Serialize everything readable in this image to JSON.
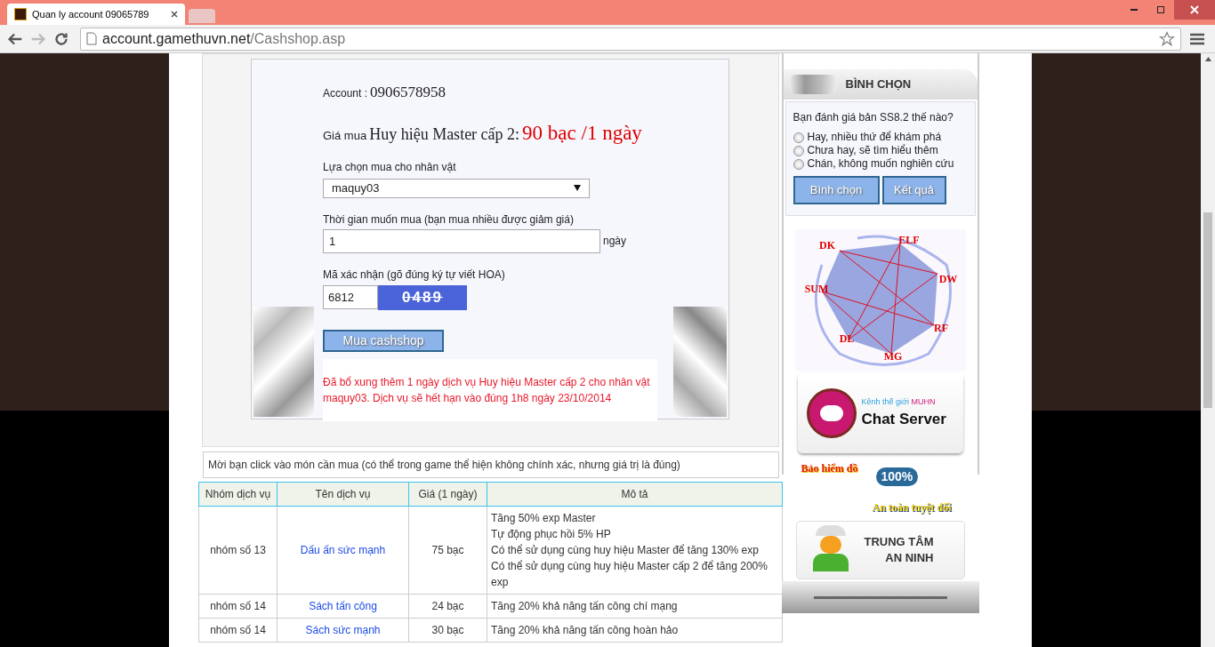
{
  "browser": {
    "tab_title": "Quan ly account 09065789",
    "url_host": "account.gamethuvn.net",
    "url_path": "/Cashshop.asp"
  },
  "form": {
    "account_label": "Account :",
    "account_value": "0906578958",
    "price_label": "Giá mua",
    "item_name": "Huy hiệu Master cấp 2:",
    "price_value": "90 bạc /1 ngày",
    "character_label": "Lựa chọn mua cho nhân vật",
    "character_value": "maquy03",
    "duration_label": "Thời gian muốn mua (bạn mua nhiều được giảm giá)",
    "duration_value": "1",
    "duration_unit": "ngày",
    "captcha_label": "Mã xác nhận (gõ đúng ký tự viết HOA)",
    "captcha_value": "6812",
    "captcha_text": "0489",
    "submit": "Mua cashshop",
    "message": "Đã bổ xung thêm 1 ngày dịch vụ Huy hiệu Master cấp 2 cho nhân vật maquy03. Dịch vụ sẽ hết hạn vào đúng 1h8 ngày 23/10/2014"
  },
  "notice": "Mời bạn click vào món cần mua (có thể trong game thể hiện không chính xác, nhưng giá trị là đúng)",
  "table": {
    "columns": [
      "Nhóm dịch vụ",
      "Tên dịch vụ",
      "Giá (1 ngày)",
      "Mô tả"
    ],
    "rows": [
      {
        "group": "nhóm số 13",
        "name": "Dấu ấn sức mạnh",
        "price": "75 bạc",
        "description": [
          "Tăng 50% exp Master",
          "Tự động phục hồi 5% HP",
          "Có thể sử dụng cùng huy hiệu Master để tăng 130% exp",
          "Có thể sử dụng cùng huy hiệu Master cấp 2 để tăng 200% exp"
        ]
      },
      {
        "group": "nhóm số 14",
        "name": "Sách tấn công",
        "price": "24 bạc",
        "description": [
          "Tăng 20% khả năng tấn công chí mạng"
        ]
      },
      {
        "group": "nhóm số 14",
        "name": "Sách sức mạnh",
        "price": "30 bạc",
        "description": [
          "Tăng 20% khả năng tấn công hoàn hảo"
        ]
      }
    ]
  },
  "poll": {
    "title": "BÌNH CHỌN",
    "question": "Bạn đánh giá bản SS8.2 thế nào?",
    "options": [
      {
        "label": "Hay, nhiều thứ để khám phá",
        "selected": false
      },
      {
        "label": "Chưa hay, sẽ tìm hiểu thêm",
        "selected": false
      },
      {
        "label": "Chán, không muốn nghiên cứu",
        "selected": false
      }
    ],
    "buttons": [
      "Bình chọn",
      "Kết quả"
    ]
  },
  "class_diagram": {
    "labels": [
      "DK",
      "ELF",
      "DW",
      "RF",
      "MG",
      "DL",
      "SUM"
    ]
  },
  "chat_banner": {
    "caption": "Kênh thế giới",
    "caption_highlight": "MUHN",
    "title": "Chat Server"
  },
  "insurance_banner": {
    "title": "Bảo hiểm đồ",
    "badge": "100%",
    "subtitle": "An toàn tuyệt đối"
  },
  "security_banner": {
    "line_1": "TRUNG TÂM",
    "line_2": "AN NINH"
  }
}
